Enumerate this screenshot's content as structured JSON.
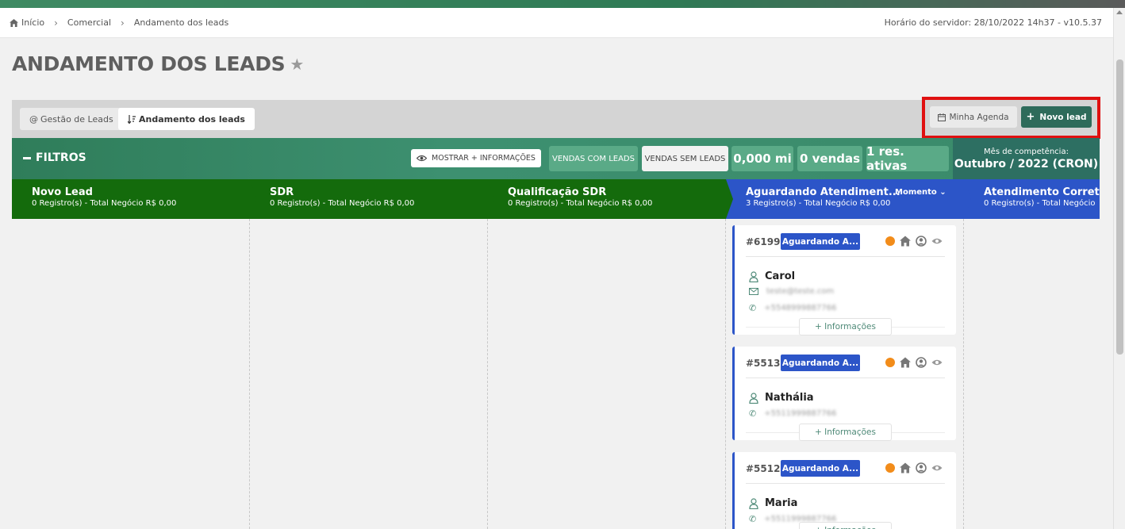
{
  "breadcrumb": {
    "home": "Início",
    "items": [
      "Comercial",
      "Andamento dos leads"
    ],
    "server_time": "Horário do servidor: 28/10/2022 14h37 - v10.5.37"
  },
  "page": {
    "title": "ANDAMENTO DOS LEADS"
  },
  "toolbar": {
    "tab_gestao": "Gestão de Leads",
    "tab_andamento": "Andamento dos leads",
    "agenda": "Minha Agenda",
    "novo_lead": "Novo lead"
  },
  "filters": {
    "title": "FILTROS",
    "mostrar": "MOSTRAR + INFORMAÇÕES",
    "vendas_com": "VENDAS COM LEADS",
    "vendas_sem": "VENDAS SEM LEADS",
    "mi": "0,000 mi",
    "vendas": "0 vendas",
    "res_ativas": "1 res. ativas",
    "competencia_label": "Mês de competência:",
    "competencia_value": "Outubro / 2022 (CRON)"
  },
  "stages": [
    {
      "name": "Novo Lead",
      "info": "0 Registro(s) - Total Negócio R$ 0,00"
    },
    {
      "name": "SDR",
      "info": "0 Registro(s) - Total Negócio R$ 0,00"
    },
    {
      "name": "Qualificação SDR",
      "info": "0 Registro(s) - Total Negócio R$ 0,00"
    },
    {
      "name": "Aguardando Atendiment...",
      "info": "3 Registro(s) - Total Negócio R$ 0,00",
      "momento": "Momento"
    },
    {
      "name": "Atendimento Corretor",
      "info": "0 Registro(s) - Total Negócio"
    }
  ],
  "cards": [
    {
      "id": "#6199",
      "status": "Aguardando A...",
      "name": "Carol",
      "email": "teste@teste.com",
      "phone": "+5548999887766",
      "more": "+ Informações"
    },
    {
      "id": "#5513",
      "status": "Aguardando A...",
      "name": "Nathália",
      "phone": "+5511999887766",
      "more": "+ Informações"
    },
    {
      "id": "#5512",
      "status": "Aguardando A...",
      "name": "Maria",
      "phone": "+5511999887766",
      "more": "+ Informações"
    }
  ],
  "colors": {
    "stage_green": "#146b0c",
    "stage_blue": "#2c55c8",
    "primary_button": "#2e6b5a",
    "status_dot": "#f28c1a",
    "highlight": "#e01010"
  }
}
